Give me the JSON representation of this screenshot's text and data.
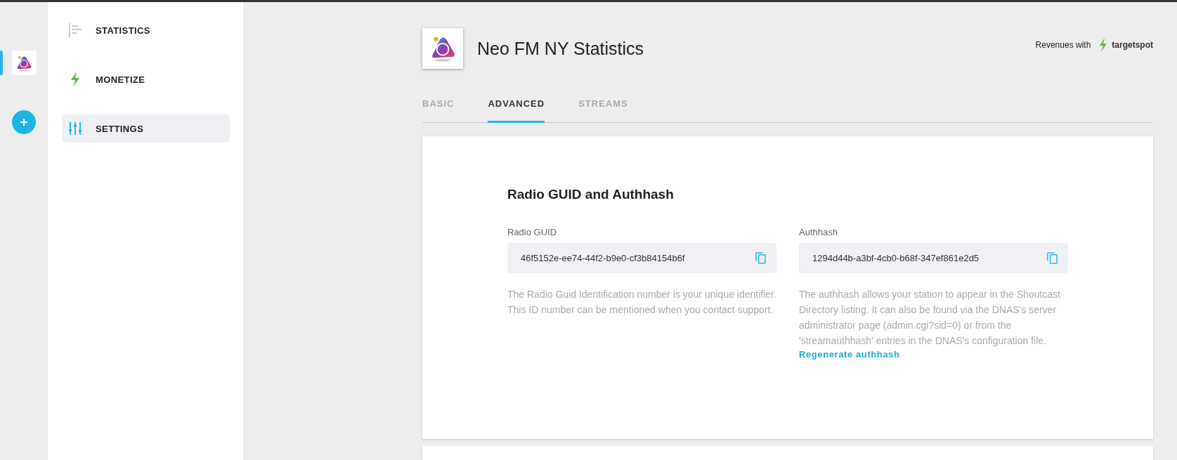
{
  "rail": {
    "stations": [
      {
        "selected": true
      }
    ]
  },
  "sidebar": {
    "items": [
      {
        "label": "STATISTICS",
        "kind": "statistics",
        "selected": false
      },
      {
        "label": "MONETIZE",
        "kind": "monetize",
        "selected": false
      },
      {
        "label": "SETTINGS",
        "kind": "settings",
        "selected": true
      }
    ]
  },
  "header": {
    "title": "Neo FM NY Statistics",
    "revenues_label": "Revenues with",
    "partner": "targetspot"
  },
  "tabs": [
    {
      "label": "BASIC",
      "selected": false
    },
    {
      "label": "ADVANCED",
      "selected": true
    },
    {
      "label": "STREAMS",
      "selected": false
    }
  ],
  "card": {
    "heading": "Radio GUID and Authhash",
    "fields": [
      {
        "label": "Radio GUID",
        "value": "46f5152e-ee74-44f2-b9e0-cf3b84154b6f",
        "description": "The Radio Guid Identification number is your unique identifier. This ID number can be mentioned when you contact support."
      },
      {
        "label": "Authhash",
        "value": "1294d44b-a3bf-4cb0-b68f-347ef861e2d5",
        "description": "The authhash allows your station to appear in the Shoutcast Directory listing. It can also be found via the DNAS's server administrator page (admin.cgi?sid=0) or from the 'streamauthhash' entries in the DNAS's configuration file.",
        "link": "Regenerate authhash"
      }
    ]
  }
}
